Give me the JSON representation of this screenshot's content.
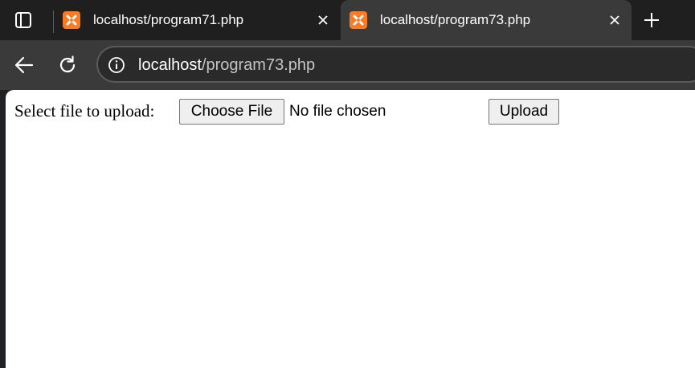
{
  "browser": {
    "tabs": [
      {
        "title": "localhost/program71.php",
        "favicon": "xampp-icon",
        "active": false
      },
      {
        "title": "localhost/program73.php",
        "favicon": "xampp-icon",
        "active": true
      }
    ],
    "address": {
      "host": "localhost",
      "path": "/program73.php"
    }
  },
  "page": {
    "label": "Select file to upload:",
    "choose_file_label": "Choose File",
    "no_file_text": "No file chosen",
    "upload_label": "Upload"
  },
  "colors": {
    "favicon": "#fb7a24",
    "tabbar": "#1f1f1f",
    "toolbar": "#3a3a3a"
  }
}
